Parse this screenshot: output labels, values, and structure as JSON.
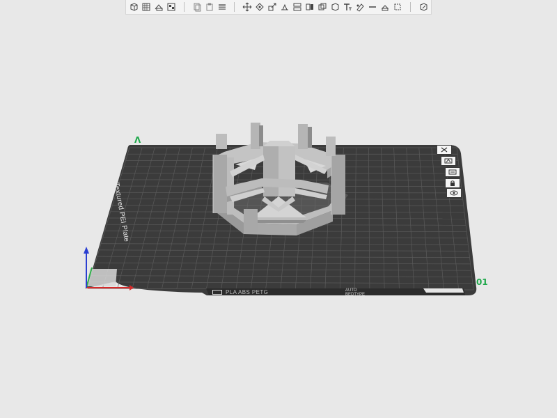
{
  "toolbar": {
    "groups": [
      {
        "items": [
          {
            "name": "add-object-icon"
          },
          {
            "name": "add-plate-icon"
          },
          {
            "name": "auto-orient-icon"
          },
          {
            "name": "arrange-icon"
          }
        ]
      },
      {
        "items": [
          {
            "name": "copy-icon"
          },
          {
            "name": "paste-icon"
          },
          {
            "name": "layers-icon"
          }
        ]
      },
      {
        "items": [
          {
            "name": "move-icon"
          },
          {
            "name": "rotate-icon"
          },
          {
            "name": "scale-icon"
          },
          {
            "name": "lay-on-face-icon"
          },
          {
            "name": "cut-icon"
          },
          {
            "name": "split-icon"
          },
          {
            "name": "boolean-icon"
          },
          {
            "name": "support-paint-icon"
          },
          {
            "name": "text-icon"
          },
          {
            "name": "seam-paint-icon"
          },
          {
            "name": "measure-icon"
          },
          {
            "name": "assembly-icon"
          },
          {
            "name": "explode-icon"
          }
        ]
      },
      {
        "items": [
          {
            "name": "variable-height-icon"
          }
        ]
      }
    ]
  },
  "plate": {
    "name": "Bambu Textured PEI Plate",
    "number": "01",
    "back_marker": "V",
    "filament": "PLA ABS PETG",
    "auto_label_line1": "AUTO",
    "auto_label_line2": "BEDTYPE",
    "color": "#3b3b3b",
    "grid_color": "#5a5a5a"
  },
  "plate_tools": [
    {
      "name": "plate-close-icon"
    },
    {
      "name": "plate-auto-arrange-icon"
    },
    {
      "name": "plate-settings-icon"
    },
    {
      "name": "plate-lock-icon"
    },
    {
      "name": "plate-view-icon"
    }
  ],
  "axes": {
    "x_color": "#d62c2c",
    "y_color": "#2fae4a",
    "z_color": "#2a3fd1"
  },
  "model": {
    "color": "#b3b3b3",
    "shadow_color": "#8e8e8e",
    "light_color": "#cfcfcf"
  }
}
